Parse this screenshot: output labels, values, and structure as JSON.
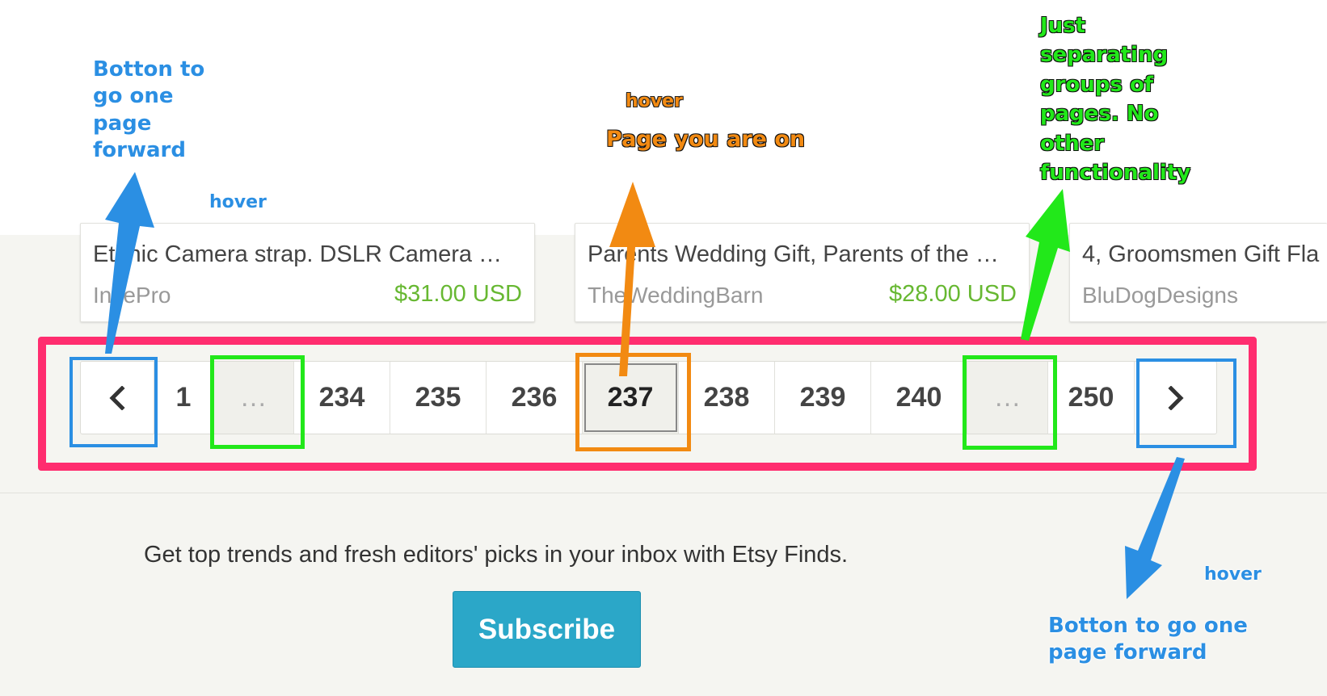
{
  "cards": [
    {
      "title": "Ethnic Camera strap. DSLR Camera …",
      "shop": "InTePro",
      "price": "$31.00 USD"
    },
    {
      "title": "Parents Wedding Gift, Parents of the …",
      "shop": "TheWeddingBarn",
      "price": "$28.00 USD"
    },
    {
      "title": "4, Groomsmen Gift Fla",
      "shop": "BluDogDesigns",
      "price": ""
    }
  ],
  "pagination": {
    "prev_icon": "chevron-left-icon",
    "next_icon": "chevron-right-icon",
    "first": "1",
    "ellipsis_left": "…",
    "pages": [
      "234",
      "235",
      "236"
    ],
    "current": "237",
    "pages_after": [
      "238",
      "239",
      "240"
    ],
    "ellipsis_right": "…",
    "last": "250"
  },
  "newsletter": {
    "text": "Get top trends and fresh editors' picks in your inbox with Etsy Finds.",
    "button": "Subscribe"
  },
  "annotations": {
    "prev_note": "Botton to\ngo one\npage\nforward",
    "prev_hover": "hover",
    "current_hover": "hover",
    "current_note": "Page you are on",
    "ellipsis_note": "Just\nseparating\ngroups of\npages. No\nother\nfunctionality",
    "next_hover": "hover",
    "next_note": "Botton to go one\npage forward",
    "colors": {
      "blue": "#2b8fe3",
      "orange": "#f28a12",
      "green": "#22e81a",
      "pink": "#ff2d6f"
    }
  }
}
